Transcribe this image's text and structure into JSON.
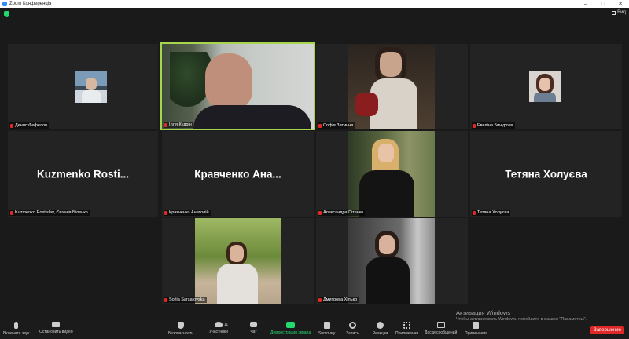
{
  "window": {
    "title": "Zoom Конференція",
    "view_label": "Вид",
    "minimize": "–",
    "maximize": "□",
    "close": "✕"
  },
  "tiles": [
    {
      "name": "Денис Фефелов",
      "style": "avatar"
    },
    {
      "name": "Ілля Кудрін",
      "style": "video",
      "active": true
    },
    {
      "name": "Софія Затинна",
      "style": "video"
    },
    {
      "name": "Евеліна Бичурова",
      "style": "avatar"
    },
    {
      "name": "Kuzmenko Rostislav, Євгенія Біленко",
      "style": "text",
      "display": "Kuzmenko  Rosti..."
    },
    {
      "name": "Кравченко Анатолій",
      "style": "text",
      "display": "Кравченко  Ана..."
    },
    {
      "name": "Александра Пітенко",
      "style": "video"
    },
    {
      "name": "Тетяна Холуєва",
      "style": "text",
      "display": "Тетяна Холуєва"
    },
    {
      "name": "Sofiia Sarsatovska",
      "style": "video"
    },
    {
      "name": "Дмитрова Хілько",
      "style": "video"
    }
  ],
  "toolbar": {
    "mute": "Включить звук",
    "video": "Остановить видео",
    "security": "Безопасность",
    "participants": "Участники",
    "participants_count": "11",
    "chat": "Чат",
    "share": "Демонстрация экрана",
    "summary": "Summary",
    "record": "Запись",
    "reactions": "Реакции",
    "apps": "Приложения",
    "whiteboard": "Доски сообщений",
    "notes": "Примечания",
    "end": "Завершение"
  },
  "watermark": {
    "line1": "Активация Windows",
    "line2": "Чтобы активировать Windows, перейдите в раздел \"Параметры\"."
  },
  "colors": {
    "active_border": "#a5d64e",
    "share_green": "#23d96e",
    "end_red": "#e02828"
  }
}
